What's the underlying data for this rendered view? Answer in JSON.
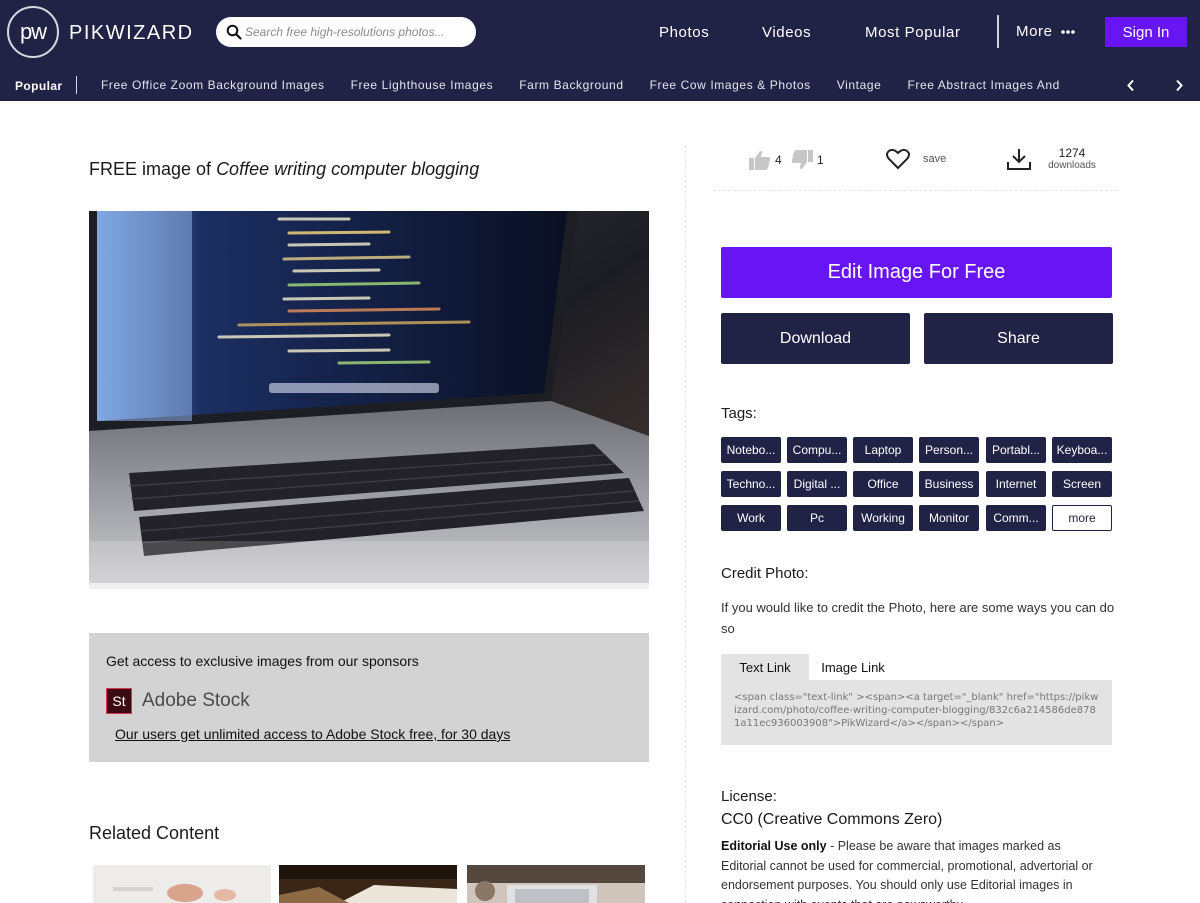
{
  "header": {
    "logo_mark": "pw",
    "logo_text": "PIKWIZARD",
    "search_placeholder": "Search free high-resolutions photos...",
    "nav": [
      "Photos",
      "Videos",
      "Most Popular"
    ],
    "more_label": "More",
    "signin_label": "Sign In",
    "colors": {
      "navy": "#212346",
      "accent": "#6815f3"
    }
  },
  "categories": {
    "popular_label": "Popular",
    "items": [
      "Free Office Zoom Background Images",
      "Free Lighthouse Images",
      "Farm Background",
      "Free Cow Images & Photos",
      "Vintage",
      "Free Abstract Images And"
    ],
    "prev_icon": "chevron-left-icon",
    "next_icon": "chevron-right-icon"
  },
  "image": {
    "title_prefix": "FREE image of",
    "title_subject": "Coffee writing computer blogging"
  },
  "sponsor": {
    "heading": "Get access to exclusive images from our sponsors",
    "logo_mark": "St",
    "brand": "Adobe Stock",
    "link_text": "Our users get unlimited access to Adobe Stock free, for 30 days"
  },
  "related": {
    "title": "Related Content"
  },
  "stats": {
    "likes": "4",
    "dislikes": "1",
    "save_label": "save",
    "downloads": "1274",
    "downloads_label": "downloads"
  },
  "actions": {
    "edit_label": "Edit Image For Free",
    "download_label": "Download",
    "share_label": "Share"
  },
  "tags": {
    "label": "Tags:",
    "items": [
      "Notebo...",
      "Compu...",
      "Laptop",
      "Person...",
      "Portabl...",
      "Keyboa...",
      "Techno...",
      "Digital ...",
      "Office",
      "Business",
      "Internet",
      "Screen",
      "Work",
      "Pc",
      "Working",
      "Monitor",
      "Comm..."
    ],
    "more_label": "more"
  },
  "credit": {
    "label": "Credit Photo:",
    "text": "If you would like to credit the Photo, here are some ways you can do so",
    "tabs": [
      "Text Link",
      "Image Link"
    ],
    "active_tab": "Text Link",
    "code": "<span class=\"text-link\" ><span><a target=\"_blank\" href=\"https://pikwizard.com/photo/coffee-writing-computer-blogging/832c6a214586de8781a11ec936003908\">PikWizard</a></span></span>"
  },
  "license": {
    "label": "License:",
    "name": "CC0 (Creative Commons Zero)",
    "editorial_label": "Editorial Use only",
    "editorial_text": " - Please be aware that images marked as Editorial cannot be used for commercial, promotional, advertorial or endorsement purposes. You should only use Editorial images in connection with events that are newsworthy."
  }
}
